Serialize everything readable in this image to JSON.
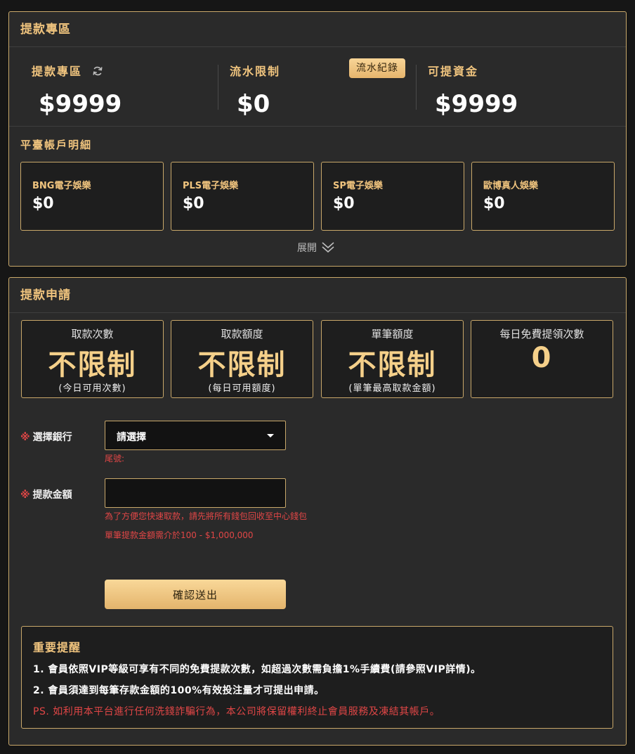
{
  "withdraw_zone": {
    "title": "提款專區",
    "summary": [
      {
        "label": "提款專區",
        "value": "$9999"
      },
      {
        "label": "流水限制",
        "value": "$0",
        "button": "流水紀錄"
      },
      {
        "label": "可提資金",
        "value": "$9999"
      }
    ],
    "platform_title": "平臺帳戶明細",
    "accounts": [
      {
        "name": "BNG電子娛樂",
        "value": "$0"
      },
      {
        "name": "PLS電子娛樂",
        "value": "$0"
      },
      {
        "name": "SP電子娛樂",
        "value": "$0"
      },
      {
        "name": "歐博真人娛樂",
        "value": "$0"
      }
    ],
    "expand_label": "展開"
  },
  "apply": {
    "title": "提款申請",
    "limits": [
      {
        "title": "取款次數",
        "value": "不限制",
        "note": "(今日可用次數)"
      },
      {
        "title": "取款額度",
        "value": "不限制",
        "note": "(每日可用額度)"
      },
      {
        "title": "單筆額度",
        "value": "不限制",
        "note": "(單筆最高取款金額)"
      },
      {
        "title": "每日免費提領次數",
        "value": "0",
        "note": ""
      }
    ],
    "bank": {
      "required_mark": "※",
      "label": "選擇銀行",
      "selected": "請選擇",
      "tail_hint": "尾號:"
    },
    "amount": {
      "required_mark": "※",
      "label": "提款金額",
      "value": "",
      "hint1": "為了方便您快速取款，請先將所有錢包回收至中心錢包",
      "hint2": "單筆提款金額需介於100 - $1,000,000"
    },
    "submit_label": "確認送出",
    "notice": {
      "title": "重要提醒",
      "line1": "1. 會員依照VIP等級可享有不同的免費提款次數，如超過次數需負擔1%手續費(請參照VIP詳情)。",
      "line2": "2. 會員須達到每筆存款金額的100%有效投注量才可提出申請。",
      "line3": "PS. 如利用本平台進行任何洗錢詐騙行為，本公司將保留權利終止會員服務及凍結其帳戶。"
    }
  },
  "colors": {
    "accent_gold": "#f0c47e",
    "border_gold": "#c9a86a",
    "warning_red": "#e04646",
    "panel_bg": "#2a2a2a"
  }
}
